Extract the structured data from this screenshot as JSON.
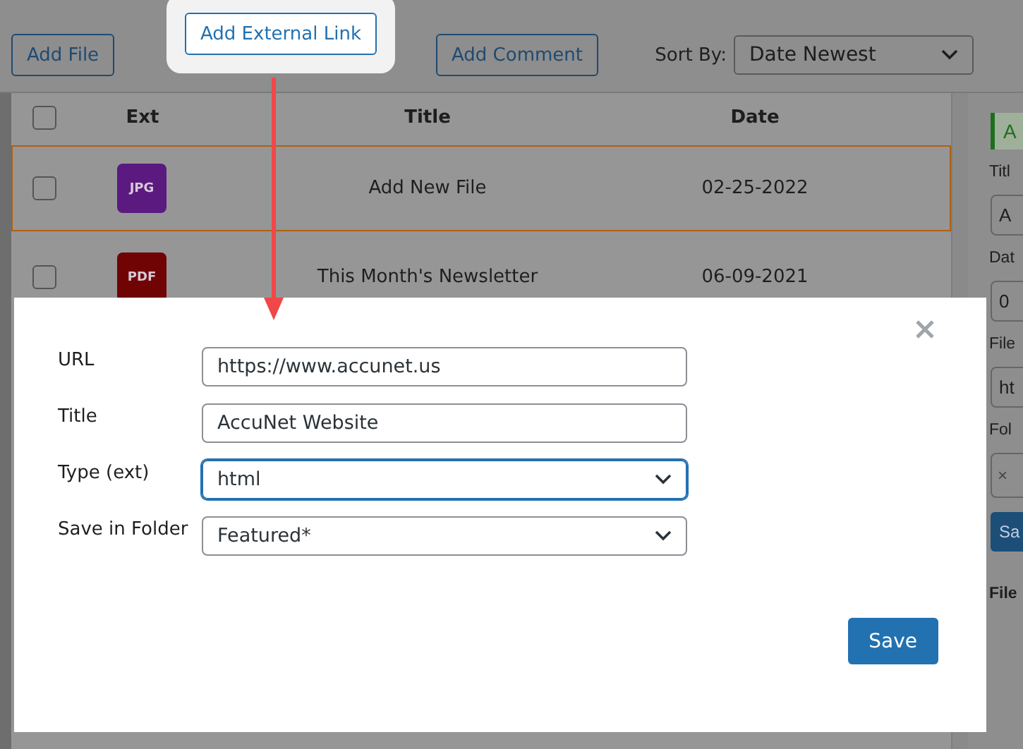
{
  "toolbar": {
    "buttons": [
      {
        "label": "Add File",
        "highlighted": false
      },
      {
        "label": "Add External Link",
        "highlighted": true
      },
      {
        "label": "Add Comment",
        "highlighted": false
      }
    ],
    "sort": {
      "label": "Sort By:",
      "value": "Date Newest"
    }
  },
  "table": {
    "select_all_checked": false,
    "columns": [
      "Ext",
      "Title",
      "Date"
    ],
    "rows": [
      {
        "ext": "JPG",
        "color": "#5a1a80",
        "title": "Add New File",
        "date": "02-25-2022",
        "checked": false,
        "selected": true
      },
      {
        "ext": "PDF",
        "color": "#700404",
        "title": "This Month's Newsletter",
        "date": "06-09-2021",
        "checked": false,
        "selected": false
      }
    ]
  },
  "sidebar": [
    {
      "kind": "notice",
      "text": "A"
    },
    {
      "kind": "label",
      "text": "Titl"
    },
    {
      "kind": "field",
      "text": "A"
    },
    {
      "kind": "label",
      "text": "Dat"
    },
    {
      "kind": "field",
      "text": "0"
    },
    {
      "kind": "label",
      "text": "File"
    },
    {
      "kind": "field",
      "text": "ht"
    },
    {
      "kind": "label",
      "text": "Fol"
    },
    {
      "kind": "tag",
      "text": "×"
    },
    {
      "kind": "button",
      "text": "Sa"
    },
    {
      "kind": "heading",
      "text": "File"
    }
  ],
  "modal": {
    "fields": [
      {
        "label": "URL",
        "kind": "input",
        "value": "https://www.accunet.us",
        "focused": false
      },
      {
        "label": "Title",
        "kind": "input",
        "value": "AccuNet Website",
        "focused": false
      },
      {
        "label": "Type (ext)",
        "kind": "select",
        "value": "html",
        "focused": true
      },
      {
        "label": "Save in Folder",
        "kind": "select",
        "value": "Featured*",
        "focused": false
      }
    ],
    "save": "Save"
  }
}
